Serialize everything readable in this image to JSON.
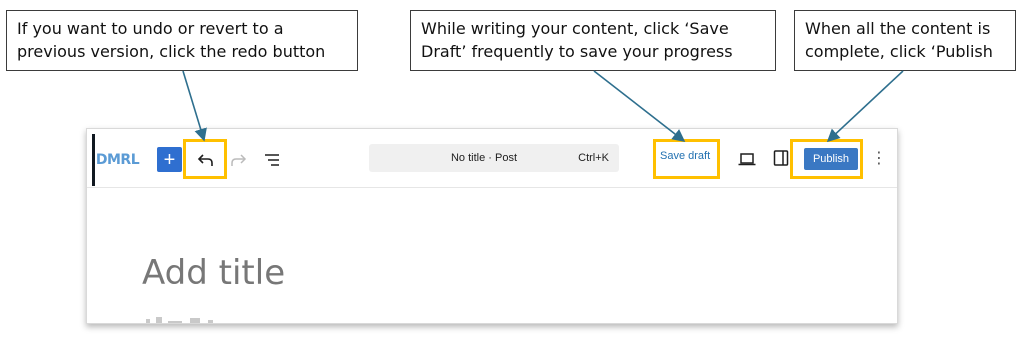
{
  "callouts": {
    "undo": {
      "line1": "If you want to undo or revert to a",
      "line2": "previous version, click the redo button"
    },
    "save": {
      "line1": "While writing your content, click ‘Save",
      "line2": "Draft’ frequently to save your progress"
    },
    "publish": {
      "line1": "When all the content is",
      "line2": "complete, click ‘Publish"
    }
  },
  "editor": {
    "logo_text": "DMRL",
    "add_label": "+",
    "command_bar": {
      "title": "No title · Post",
      "shortcut": "Ctrl+K"
    },
    "save_draft_label": "Save draft",
    "publish_label": "Publish",
    "options_label": "⋮",
    "title_placeholder": "Add title"
  },
  "icons": {
    "undo": "undo-icon",
    "redo": "redo-icon",
    "list_view": "list-view-icon",
    "preview": "laptop-preview-icon",
    "sidebar": "sidebar-toggle-icon"
  },
  "colors": {
    "highlight": "#ffc000",
    "arrow": "#2e6f8e",
    "accent": "#2f6fd0",
    "publish": "#3a78c3",
    "link": "#2271b1"
  }
}
